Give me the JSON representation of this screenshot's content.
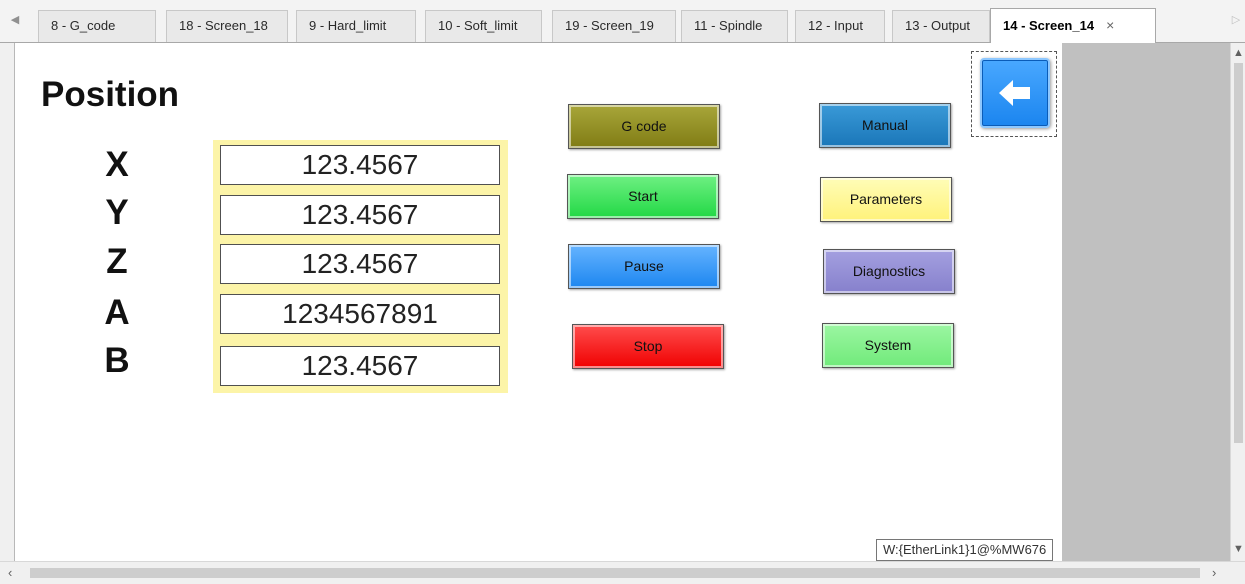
{
  "tabs": [
    {
      "label": "8 - G_code"
    },
    {
      "label": "18 - Screen_18"
    },
    {
      "label": "9 - Hard_limit"
    },
    {
      "label": "10 - Soft_limit"
    },
    {
      "label": "19 - Screen_19"
    },
    {
      "label": "11 - Spindle"
    },
    {
      "label": "12 - Input"
    },
    {
      "label": "13 - Output"
    },
    {
      "label": "14 - Screen_14",
      "active": true
    }
  ],
  "tab_close_glyph": "×",
  "screen": {
    "title": "Position",
    "axes": [
      {
        "label": "X",
        "value": "123.4567"
      },
      {
        "label": "Y",
        "value": "123.4567"
      },
      {
        "label": "Z",
        "value": "123.4567"
      },
      {
        "label": "A",
        "value": "1234567891"
      },
      {
        "label": "B",
        "value": "123.4567"
      }
    ],
    "buttons": {
      "gcode": "G code",
      "start": "Start",
      "pause": "Pause",
      "stop": "Stop",
      "manual": "Manual",
      "parameters": "Parameters",
      "diagnostics": "Diagnostics",
      "system": "System"
    },
    "back_icon": "left-arrow-icon"
  },
  "tooltip": "W:{EtherLink1}1@%MW676",
  "colors": {
    "gcode": "#8a8620",
    "start": "#33e055",
    "pause": "#2a90f5",
    "stop": "#f51010",
    "manual": "#2284c8",
    "parameters": "#fff48a",
    "diagnostics": "#938ed6",
    "system": "#7cee86",
    "value_panel": "#fcf4a8",
    "back_button": "#2a90f5"
  }
}
